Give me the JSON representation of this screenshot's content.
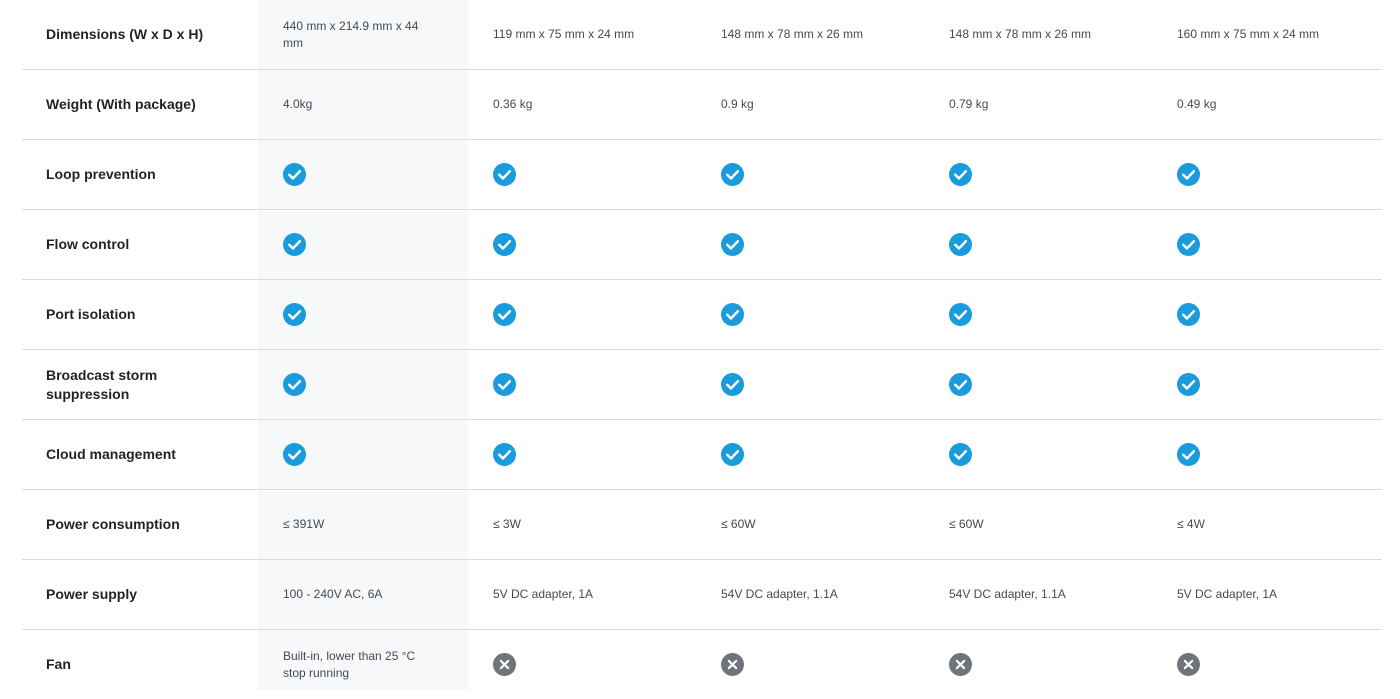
{
  "colors": {
    "check": "#1a9bdb",
    "cross": "#6f747a",
    "divider": "#d9dcdf",
    "highlight": "#f6f8fa"
  },
  "rows": [
    {
      "label": "Dimensions (W x D x H)",
      "cells": [
        {
          "type": "text",
          "value": "440 mm x 214.9 mm x 44 mm"
        },
        {
          "type": "text",
          "value": "119 mm x 75 mm x 24 mm"
        },
        {
          "type": "text",
          "value": "148 mm x 78 mm x 26 mm"
        },
        {
          "type": "text",
          "value": "148 mm x 78 mm x 26 mm"
        },
        {
          "type": "text",
          "value": "160 mm x 75 mm x 24 mm"
        }
      ]
    },
    {
      "label": "Weight (With package)",
      "cells": [
        {
          "type": "text",
          "value": "4.0kg"
        },
        {
          "type": "text",
          "value": "0.36 kg"
        },
        {
          "type": "text",
          "value": "0.9 kg"
        },
        {
          "type": "text",
          "value": "0.79 kg"
        },
        {
          "type": "text",
          "value": "0.49 kg"
        }
      ]
    },
    {
      "label": "Loop prevention",
      "cells": [
        {
          "type": "icon",
          "value": "check-circle-icon"
        },
        {
          "type": "icon",
          "value": "check-circle-icon"
        },
        {
          "type": "icon",
          "value": "check-circle-icon"
        },
        {
          "type": "icon",
          "value": "check-circle-icon"
        },
        {
          "type": "icon",
          "value": "check-circle-icon"
        }
      ]
    },
    {
      "label": "Flow control",
      "cells": [
        {
          "type": "icon",
          "value": "check-circle-icon"
        },
        {
          "type": "icon",
          "value": "check-circle-icon"
        },
        {
          "type": "icon",
          "value": "check-circle-icon"
        },
        {
          "type": "icon",
          "value": "check-circle-icon"
        },
        {
          "type": "icon",
          "value": "check-circle-icon"
        }
      ]
    },
    {
      "label": "Port isolation",
      "cells": [
        {
          "type": "icon",
          "value": "check-circle-icon"
        },
        {
          "type": "icon",
          "value": "check-circle-icon"
        },
        {
          "type": "icon",
          "value": "check-circle-icon"
        },
        {
          "type": "icon",
          "value": "check-circle-icon"
        },
        {
          "type": "icon",
          "value": "check-circle-icon"
        }
      ]
    },
    {
      "label": "Broadcast storm suppression",
      "cells": [
        {
          "type": "icon",
          "value": "check-circle-icon"
        },
        {
          "type": "icon",
          "value": "check-circle-icon"
        },
        {
          "type": "icon",
          "value": "check-circle-icon"
        },
        {
          "type": "icon",
          "value": "check-circle-icon"
        },
        {
          "type": "icon",
          "value": "check-circle-icon"
        }
      ]
    },
    {
      "label": "Cloud management",
      "cells": [
        {
          "type": "icon",
          "value": "check-circle-icon"
        },
        {
          "type": "icon",
          "value": "check-circle-icon"
        },
        {
          "type": "icon",
          "value": "check-circle-icon"
        },
        {
          "type": "icon",
          "value": "check-circle-icon"
        },
        {
          "type": "icon",
          "value": "check-circle-icon"
        }
      ]
    },
    {
      "label": "Power consumption",
      "cells": [
        {
          "type": "text",
          "value": "≤ 391W"
        },
        {
          "type": "text",
          "value": "≤ 3W"
        },
        {
          "type": "text",
          "value": "≤ 60W"
        },
        {
          "type": "text",
          "value": "≤ 60W"
        },
        {
          "type": "text",
          "value": "≤ 4W"
        }
      ]
    },
    {
      "label": "Power supply",
      "cells": [
        {
          "type": "text",
          "value": "100 - 240V AC, 6A"
        },
        {
          "type": "text",
          "value": "5V DC adapter, 1A"
        },
        {
          "type": "text",
          "value": "54V DC adapter, 1.1A"
        },
        {
          "type": "text",
          "value": "54V DC adapter, 1.1A"
        },
        {
          "type": "text",
          "value": "5V DC adapter, 1A"
        }
      ]
    },
    {
      "label": "Fan",
      "cells": [
        {
          "type": "text",
          "value": "Built-in, lower than 25 °C stop running"
        },
        {
          "type": "icon",
          "value": "cross-circle-icon"
        },
        {
          "type": "icon",
          "value": "cross-circle-icon"
        },
        {
          "type": "icon",
          "value": "cross-circle-icon"
        },
        {
          "type": "icon",
          "value": "cross-circle-icon"
        }
      ]
    }
  ]
}
